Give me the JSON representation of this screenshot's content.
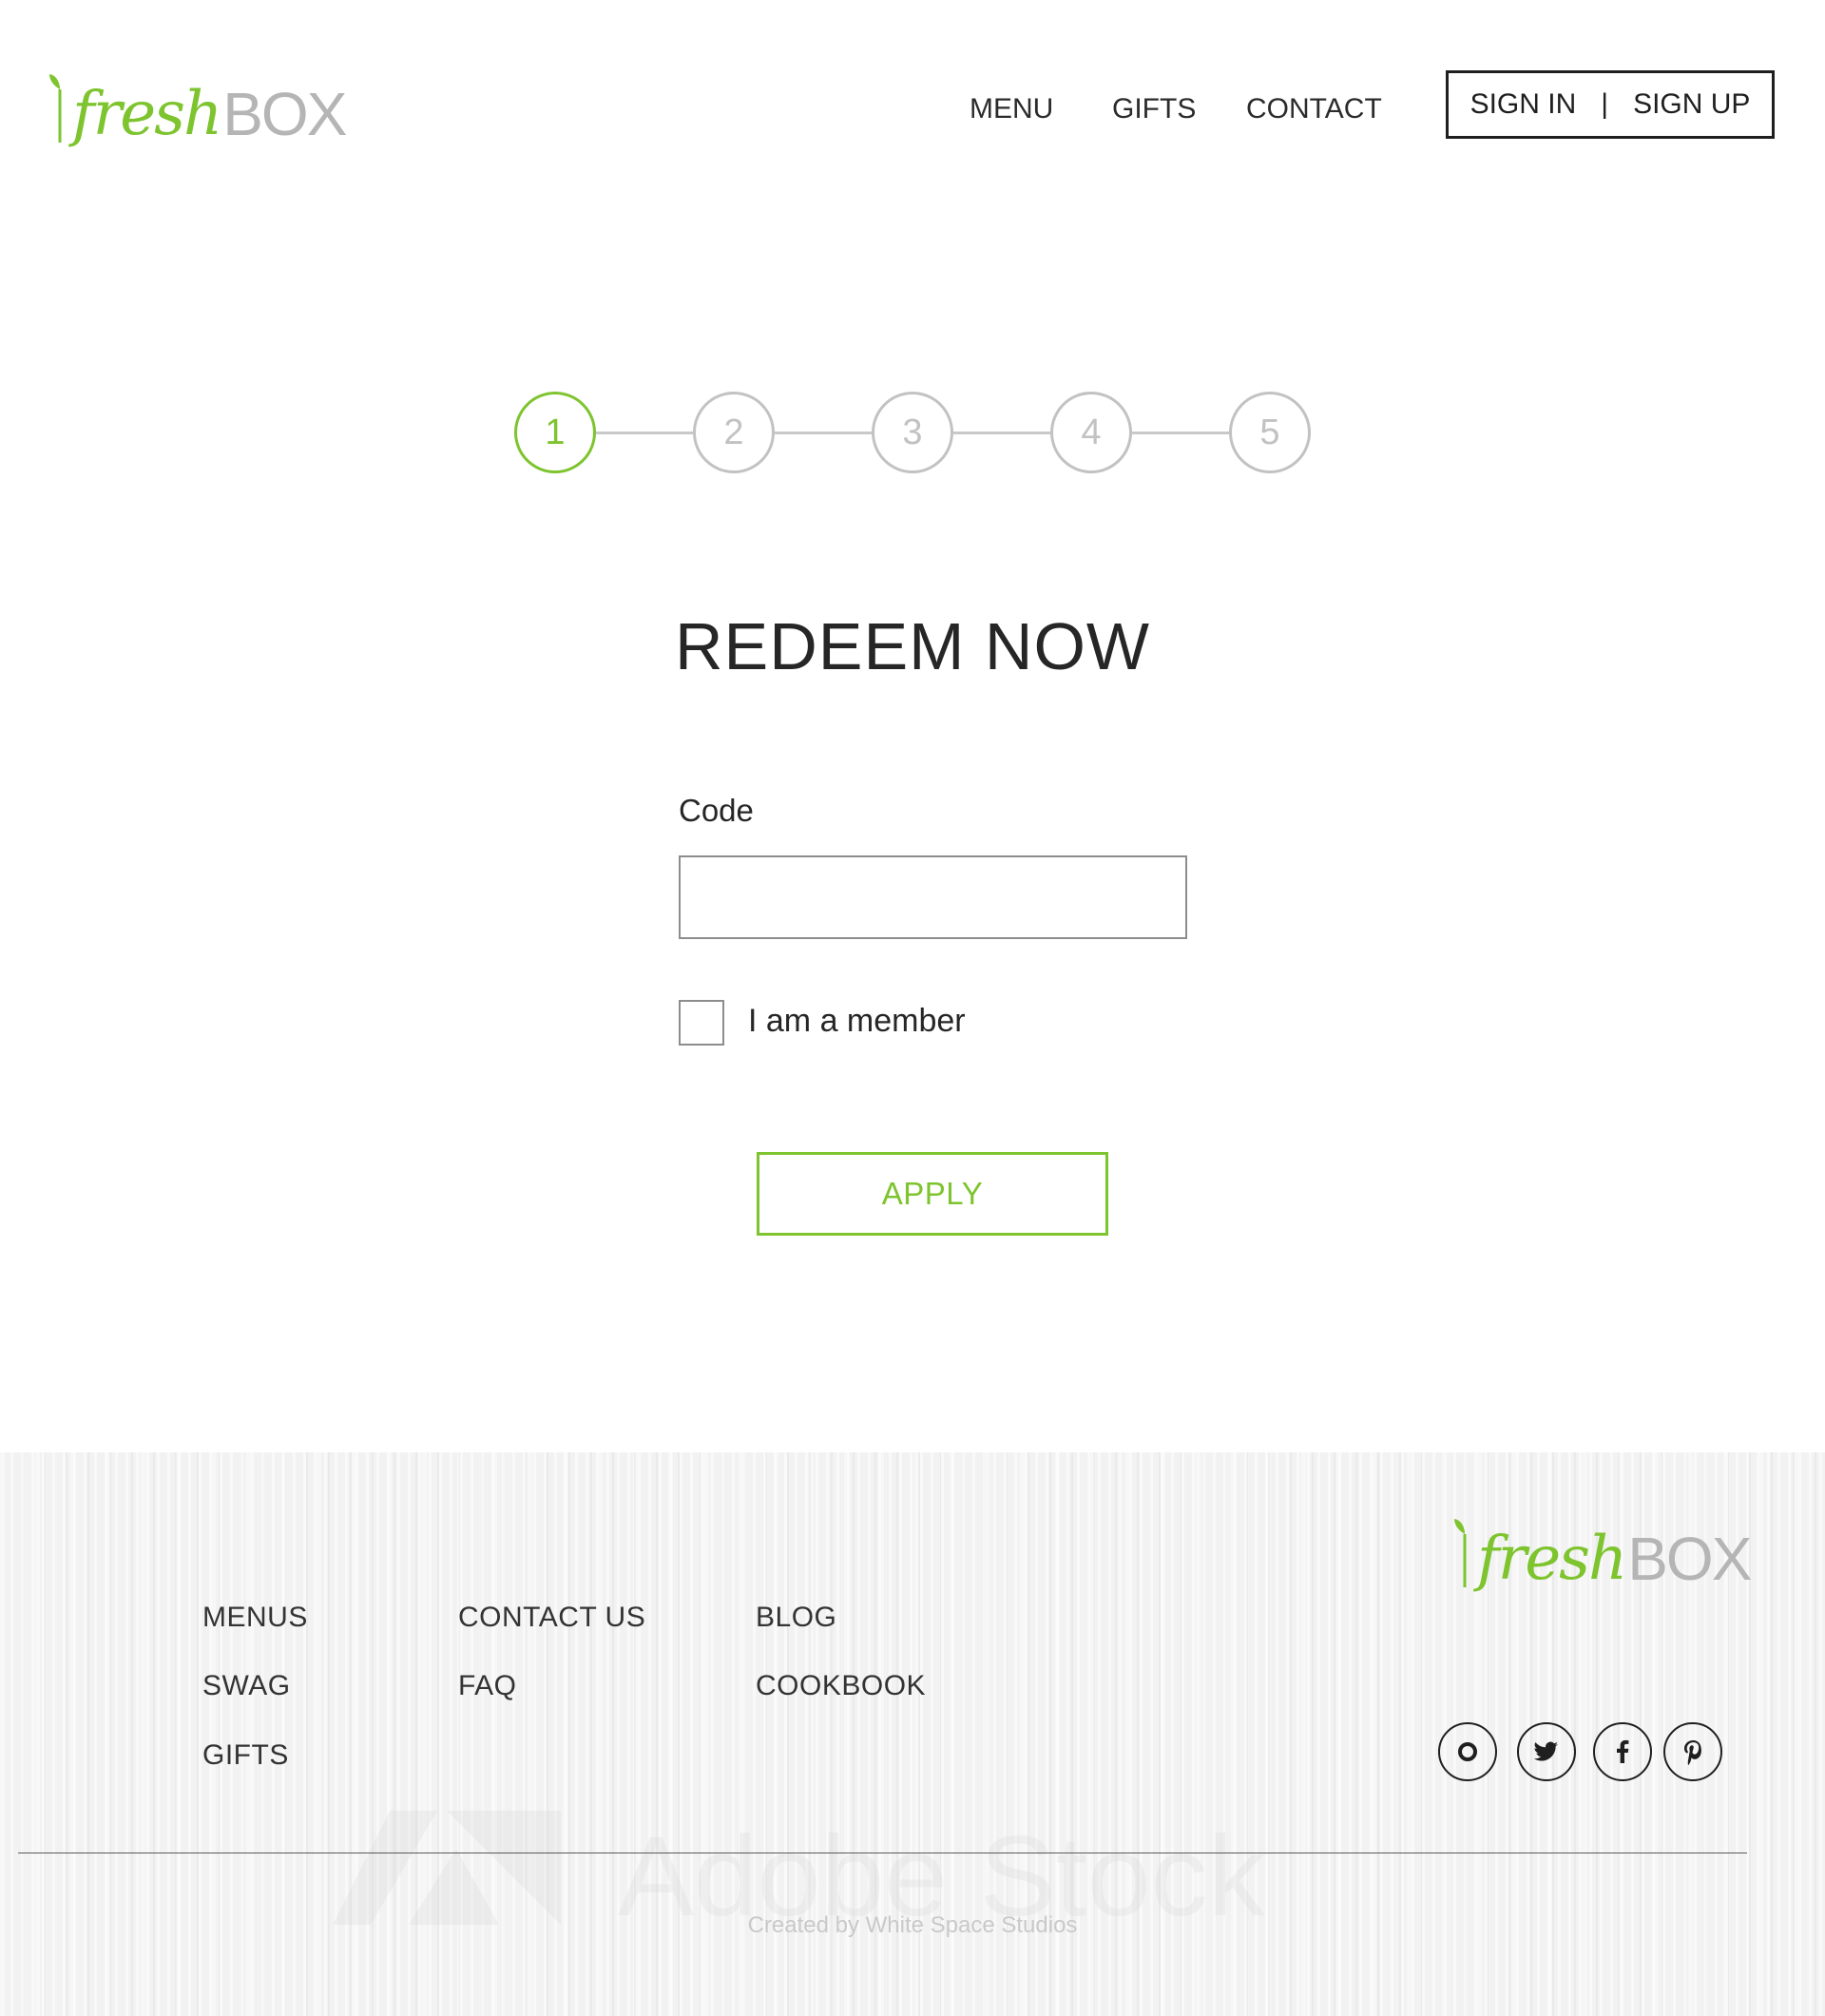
{
  "header": {
    "logo": {
      "fresh": "fresh",
      "box": "BOX"
    },
    "nav": [
      "MENU",
      "GIFTS",
      "CONTACT"
    ],
    "auth": {
      "sign_in": "SIGN IN",
      "separator": "|",
      "sign_up": "SIGN UP"
    }
  },
  "stepper": {
    "steps": [
      "1",
      "2",
      "3",
      "4",
      "5"
    ],
    "current_step": 1,
    "active_color": "#7ec42f",
    "inactive_color": "#c2c2c2"
  },
  "form": {
    "title": "REDEEM NOW",
    "code_label": "Code",
    "code_value": "",
    "member_checkbox_label": "I am a member",
    "member_checked": false,
    "apply_label": "APPLY"
  },
  "footer": {
    "logo": {
      "fresh": "fresh",
      "box": "BOX"
    },
    "links": {
      "col1": [
        "MENUS",
        "SWAG",
        "GIFTS"
      ],
      "col2": [
        "CONTACT US",
        "FAQ"
      ],
      "col3": [
        "BLOG",
        "COOKBOOK"
      ]
    },
    "social_icons": [
      "instagram-icon",
      "twitter-icon",
      "facebook-icon",
      "pinterest-icon"
    ],
    "credit": "Created by White Space Studios",
    "watermark": "Adobe Stock"
  },
  "colors": {
    "brand_green": "#7ec42f",
    "logo_gray": "#b5b5b5",
    "text_dark": "#262626"
  }
}
